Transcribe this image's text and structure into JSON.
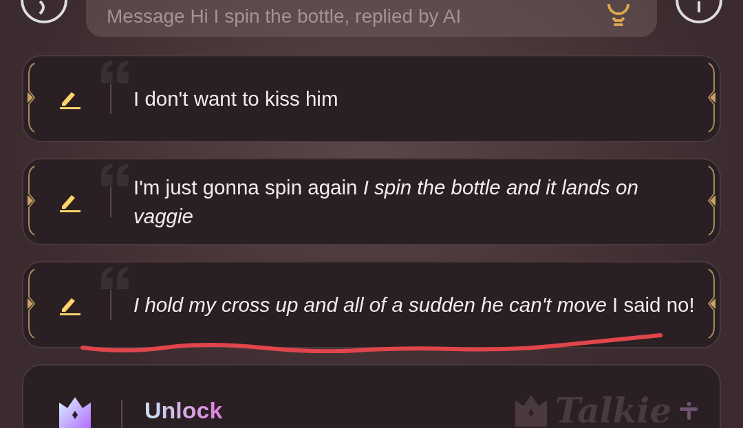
{
  "composer": {
    "placeholder": "Message Hi I spin the bottle, replied by AI"
  },
  "suggestions": [
    {
      "text": "I don't want to kiss him"
    },
    {
      "text": "I'm just gonna spin again *I spin the bottle and it lands on vaggie*"
    },
    {
      "text": "*I hold my cross up and all of a sudden he can't move* I said no!"
    }
  ],
  "unlock": {
    "label": "Unlock",
    "brand": "Talkie"
  }
}
